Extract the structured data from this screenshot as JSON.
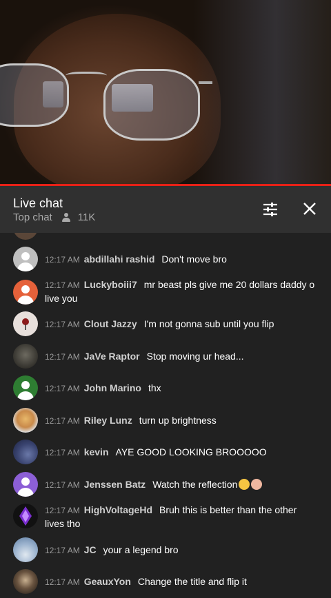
{
  "chat": {
    "title": "Live chat",
    "mode": "Top chat",
    "viewers": "11K"
  },
  "messages": [
    {
      "time": "12:17 AM",
      "author": "abdillahi rashid",
      "text": "Don't move bro",
      "avatar": "generic-gray"
    },
    {
      "time": "12:17 AM",
      "author": "Luckyboiii7",
      "text": "mr beast pls give me 20 dollars daddy o live you",
      "avatar": "generic-orange"
    },
    {
      "time": "12:17 AM",
      "author": "Clout Jazzy",
      "text": "I'm not gonna sub until you flip",
      "avatar": "rose-image"
    },
    {
      "time": "12:17 AM",
      "author": "JaVe Raptor",
      "text": "Stop moving ur head...",
      "avatar": "photo"
    },
    {
      "time": "12:17 AM",
      "author": "John Marino",
      "text": "thx",
      "avatar": "generic-green"
    },
    {
      "time": "12:17 AM",
      "author": "Riley Lunz",
      "text": "turn up brightness",
      "avatar": "cartoon"
    },
    {
      "time": "12:17 AM",
      "author": "kevin",
      "text": "AYE GOOD LOOKING BROOOOO",
      "avatar": "photo-blue"
    },
    {
      "time": "12:17 AM",
      "author": "Jenssen Batz",
      "text": "Watch the reflection",
      "avatar": "generic-purple"
    },
    {
      "time": "12:17 AM",
      "author": "HighVoltageHd",
      "text": "Bruh this is better than the other lives tho",
      "avatar": "purple-crystal"
    },
    {
      "time": "12:17 AM",
      "author": "JC",
      "text": "your a legend bro",
      "avatar": "sky-photo"
    },
    {
      "time": "12:17 AM",
      "author": "GeauxYon",
      "text": "Change the title and flip it",
      "avatar": "dark-photo"
    }
  ],
  "colors": {
    "background": "#212121",
    "header": "#303030",
    "progress": "#e62117",
    "time": "#9a9a9a",
    "author": "#d0d0d0"
  }
}
